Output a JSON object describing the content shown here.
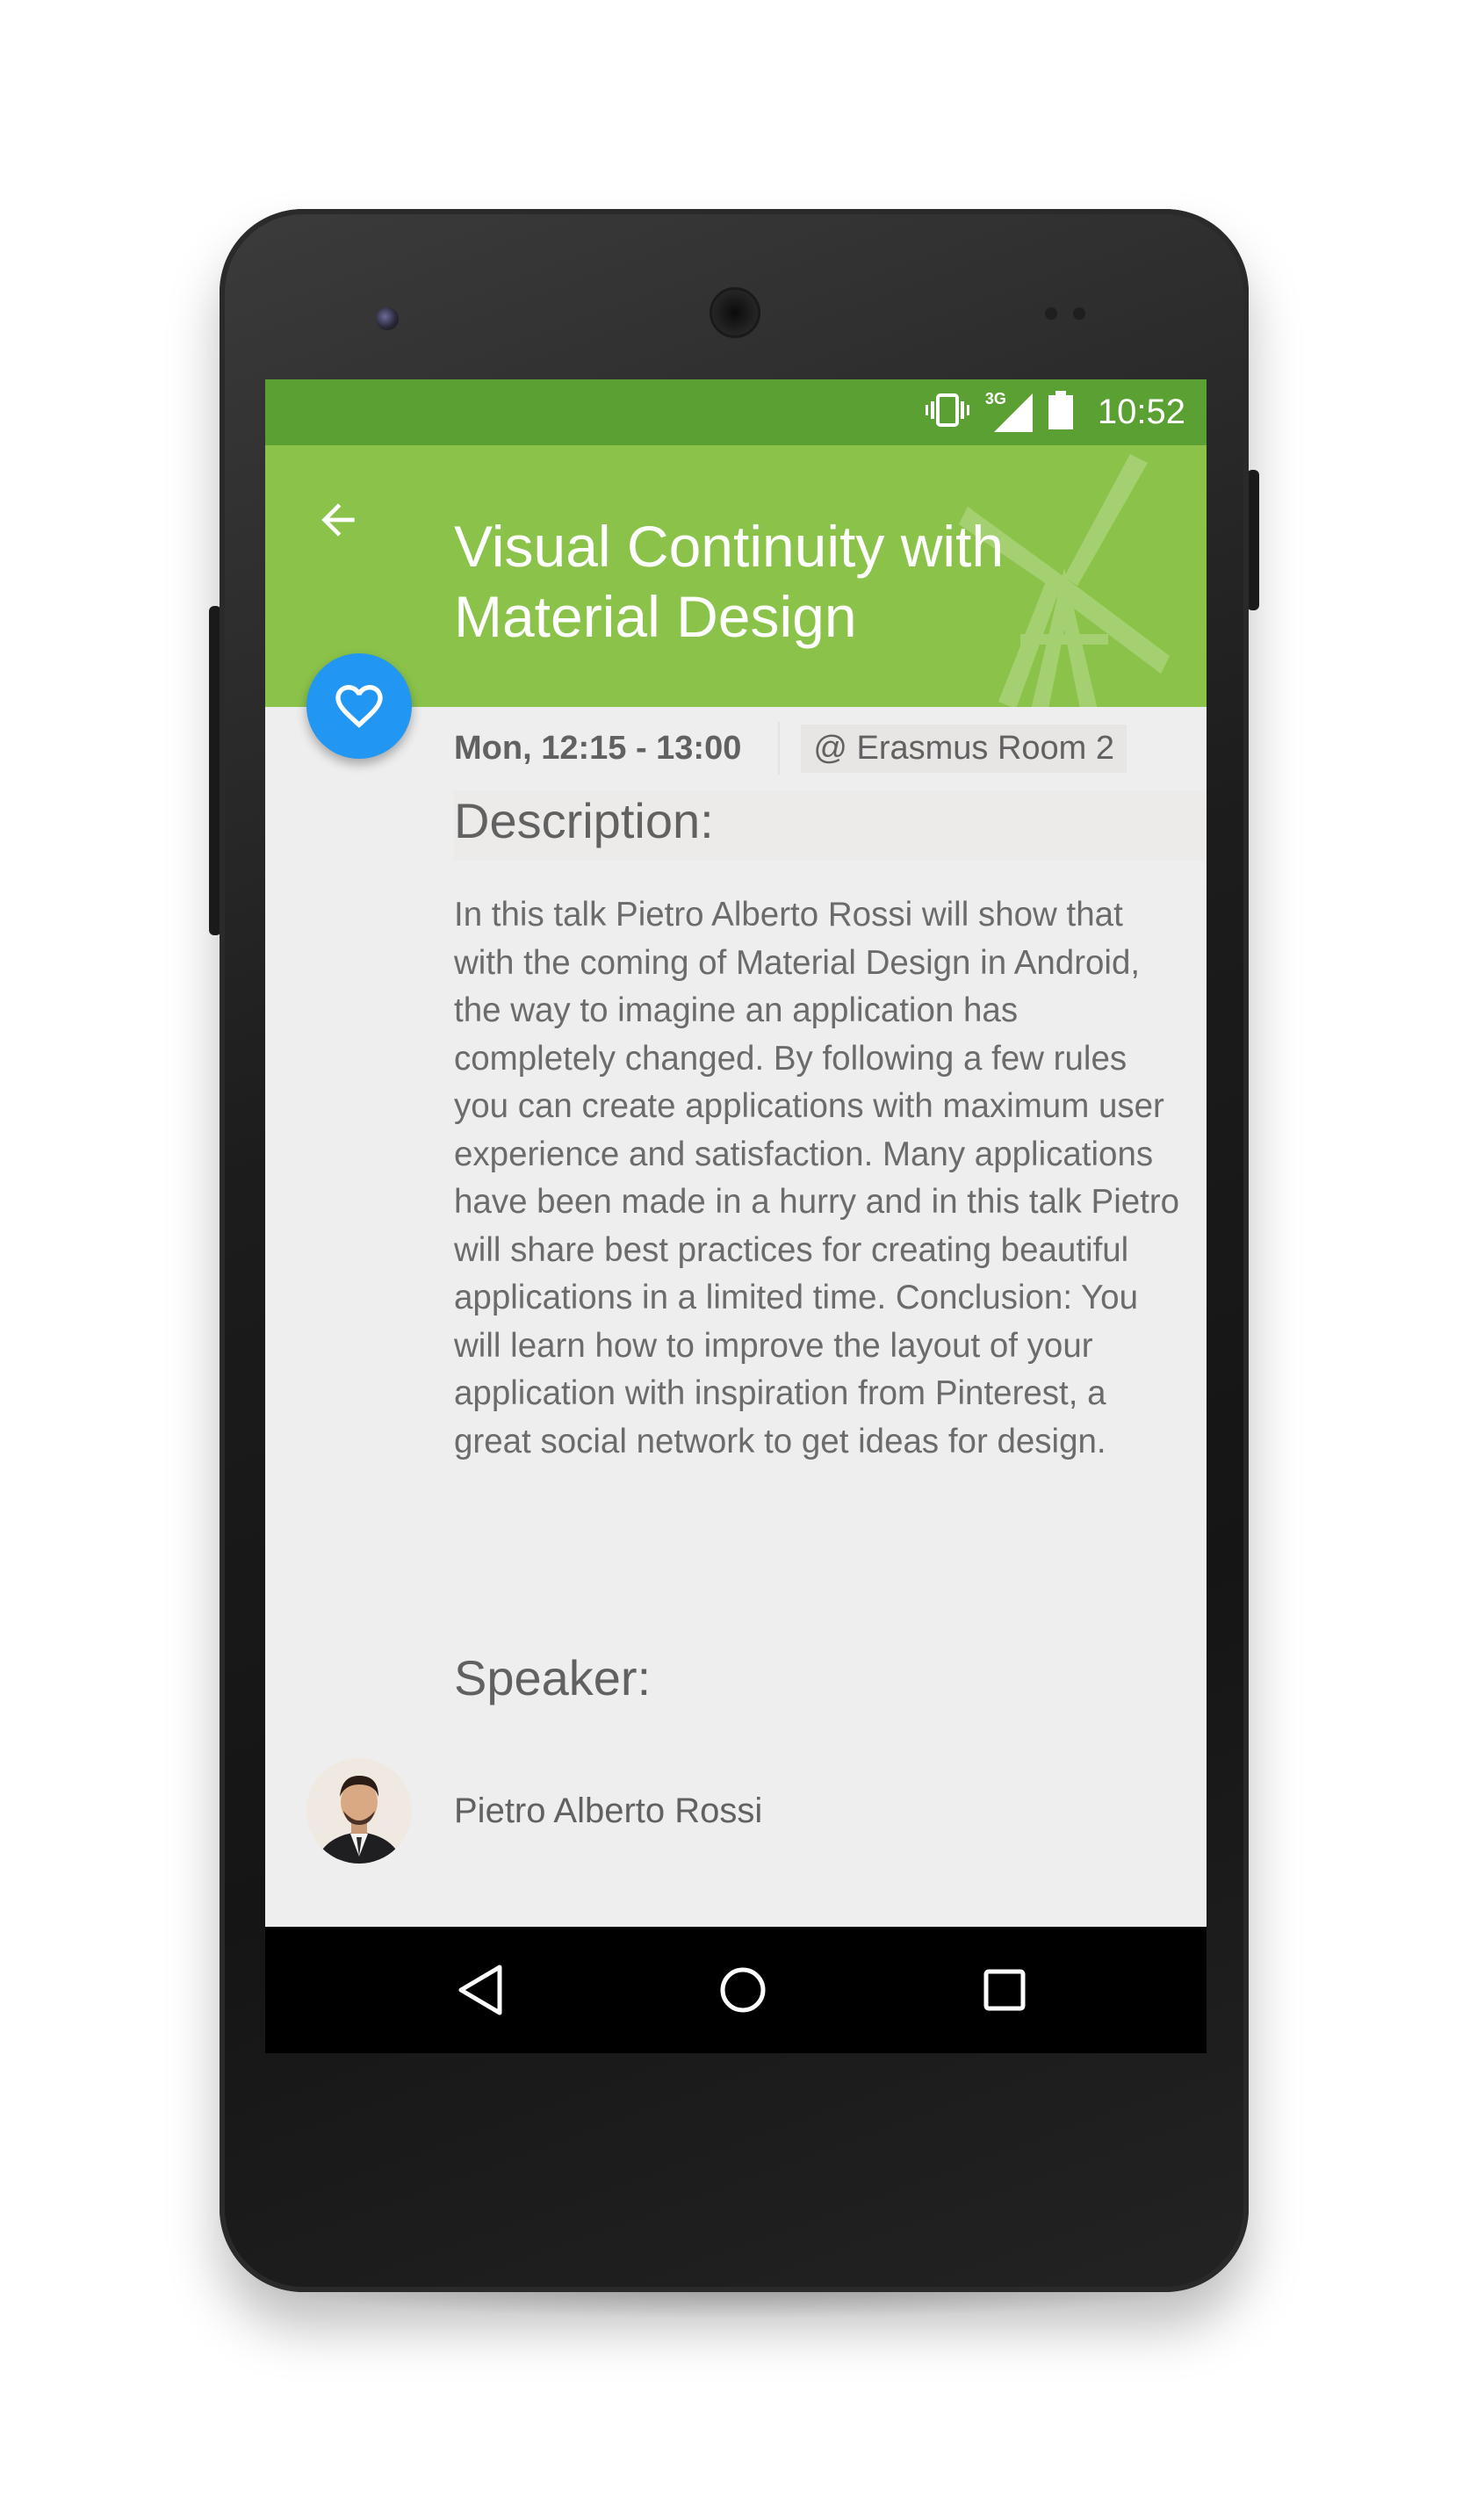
{
  "status_bar": {
    "network": "3G",
    "time": "10:52"
  },
  "app_bar": {
    "title": "Visual Continuity with Material Design",
    "back_icon": "arrow-back-icon",
    "background_icon": "windmill-icon",
    "color": "#8bc34a",
    "status_color": "#5ba033"
  },
  "fab": {
    "icon": "heart-outline-icon",
    "color": "#2196f3"
  },
  "session": {
    "time": "Mon, 12:15 - 13:00",
    "room": "@ Erasmus Room 2"
  },
  "description": {
    "heading": "Description:",
    "text": "In this talk Pietro Alberto Rossi will show that with the coming of Material Design in Android, the way to imagine an application has completely changed. By following a few rules you can create applications with maximum user experience and satisfaction. Many applications have been made in a hurry and in this talk Pietro will share best practices for creating beautiful applications in a limited time.   Conclusion: You will learn how to improve the layout of your application with inspiration from Pinterest, a great social network to get ideas for design."
  },
  "speaker": {
    "heading": "Speaker:",
    "name": "Pietro Alberto Rossi"
  },
  "nav_bar": {
    "back_icon": "nav-back-icon",
    "home_icon": "nav-home-icon",
    "recents_icon": "nav-recents-icon"
  }
}
